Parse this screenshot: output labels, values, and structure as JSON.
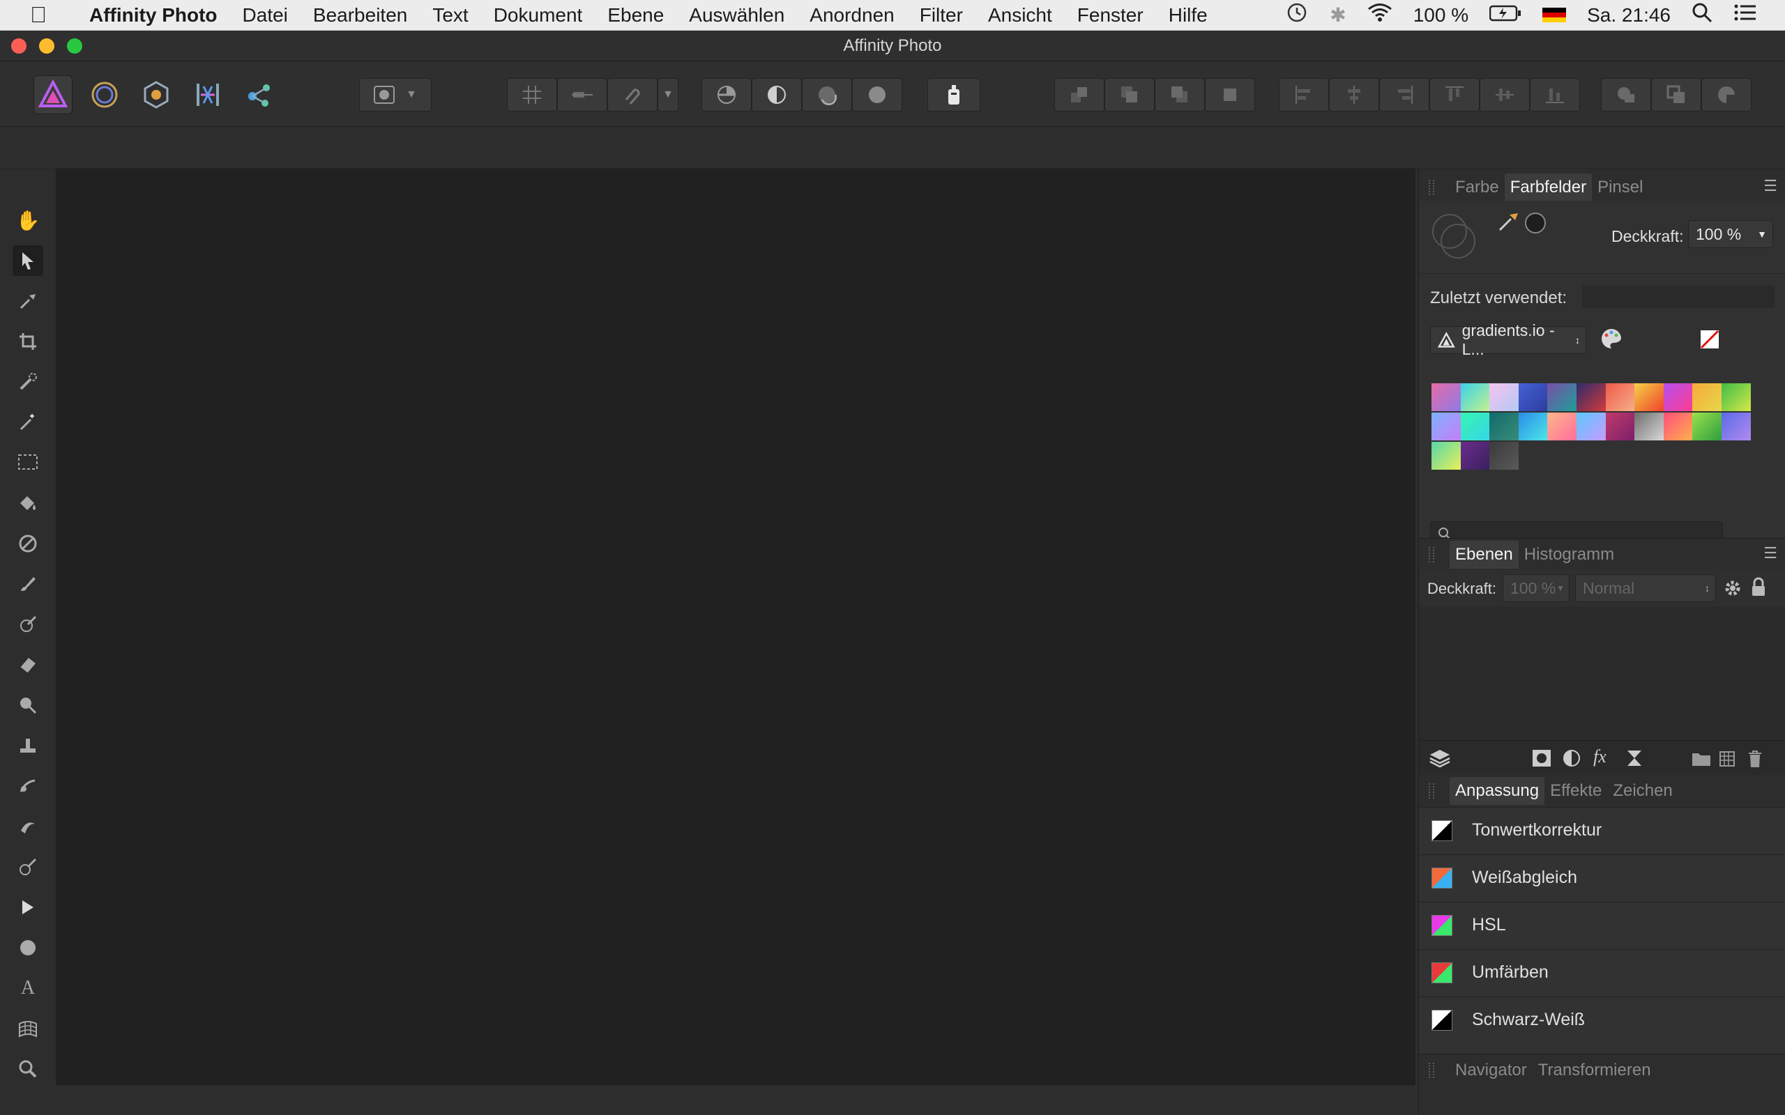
{
  "menubar": {
    "app": "Affinity Photo",
    "items": [
      "Datei",
      "Bearbeiten",
      "Text",
      "Dokument",
      "Ebene",
      "Auswählen",
      "Anordnen",
      "Filter",
      "Ansicht",
      "Fenster",
      "Hilfe"
    ],
    "battery": "100 %",
    "clock": "Sa. 21:46"
  },
  "window": {
    "title": "Affinity Photo"
  },
  "swatches_panel": {
    "tabs": [
      "Farbe",
      "Farbfelder",
      "Pinsel"
    ],
    "selected_tab": "Farbfelder",
    "opacity_label": "Deckkraft:",
    "opacity_value": "100 %",
    "recent_label": "Zuletzt verwendet:",
    "palette_name": "gradients.io - L...",
    "search_placeholder": "",
    "gradients": [
      [
        "#e86ba6",
        "#8d7be6"
      ],
      [
        "#37d1e8",
        "#c7f28d"
      ],
      [
        "#f4c3ef",
        "#b6c8f5"
      ],
      [
        "#4561d6",
        "#2c3c9e"
      ],
      [
        "#7a4fa6",
        "#1e9e9a"
      ],
      [
        "#2e2a6b",
        "#d23b3b"
      ],
      [
        "#f05a4a",
        "#f6b18a"
      ],
      [
        "#f7d046",
        "#f0432b"
      ],
      [
        "#b34ff0",
        "#ff3d8d"
      ],
      [
        "#f7a93a",
        "#e6d84a"
      ],
      [
        "#3fbb48",
        "#d5ea47"
      ],
      [
        "#7db2ff",
        "#c77df7"
      ],
      [
        "#36f5b0",
        "#36d6e8"
      ],
      [
        "#126b6b",
        "#3a8c7a"
      ],
      [
        "#2b8ce8",
        "#4be8e8"
      ],
      [
        "#ffb68a",
        "#ff6e9b"
      ],
      [
        "#5ac8ff",
        "#c89bff"
      ],
      [
        "#c23a6b",
        "#7a1f6b"
      ],
      [
        "#6e6e6e",
        "#d8d8d8"
      ],
      [
        "#ff4e7a",
        "#ffb14e"
      ],
      [
        "#9be24d",
        "#2c9e3d"
      ],
      [
        "#5a6be8",
        "#b28af0"
      ],
      [
        "#58d6a8",
        "#e8f05a"
      ],
      [
        "#6b2d8c",
        "#3a1f5e"
      ],
      [
        "#3a3a3a",
        "#5a5a5a"
      ]
    ]
  },
  "layers_panel": {
    "tabs": [
      "Ebenen",
      "Histogramm"
    ],
    "selected_tab": "Ebenen",
    "opacity_label": "Deckkraft:",
    "opacity_value": "100 %",
    "blend_mode": "Normal"
  },
  "adjust_panel": {
    "tabs": [
      "Anpassung",
      "Effekte",
      "Zeichen"
    ],
    "selected_tab": "Anpassung",
    "items": [
      {
        "label": "Tonwertkorrektur",
        "icon": "levels-icon",
        "colors": [
          "#ffffff",
          "#000000"
        ]
      },
      {
        "label": "Weißabgleich",
        "icon": "white-balance-icon",
        "colors": [
          "#f26a3a",
          "#3ab0f2"
        ]
      },
      {
        "label": "HSL",
        "icon": "hsl-icon",
        "colors": [
          "#e83ae8",
          "#3ae86b"
        ]
      },
      {
        "label": "Umfärben",
        "icon": "recolor-icon",
        "colors": [
          "#e83a3a",
          "#3ae86b"
        ]
      },
      {
        "label": "Schwarz-Weiß",
        "icon": "black-white-icon",
        "colors": [
          "#ffffff",
          "#000000"
        ]
      }
    ]
  },
  "bottom_panel": {
    "tabs": [
      "Navigator",
      "Transformieren"
    ]
  }
}
